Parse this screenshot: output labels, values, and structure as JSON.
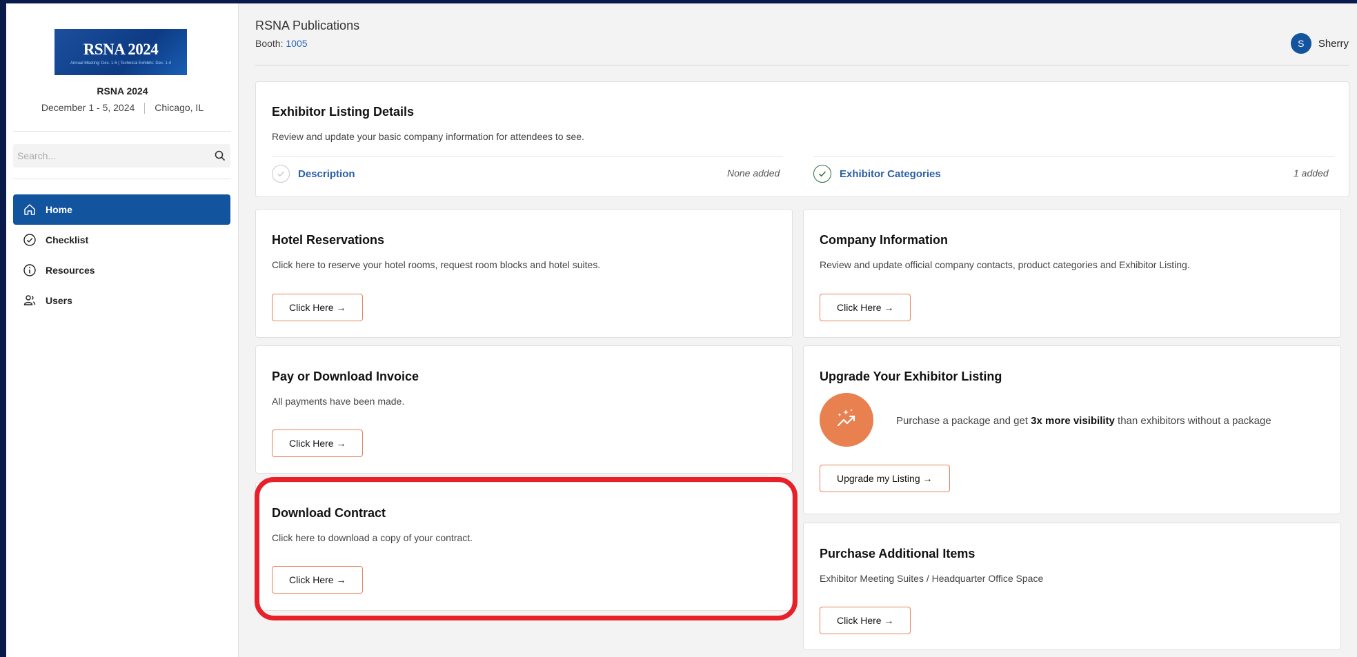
{
  "sidebar": {
    "logo": {
      "title": "RSNA 2024",
      "subtitle": "Annual Meeting: Dec. 1-5 | Technical Exhibits: Dec. 1-4"
    },
    "event_name": "RSNA 2024",
    "event_dates": "December 1 - 5, 2024",
    "event_location": "Chicago, IL",
    "search_placeholder": "Search...",
    "nav": [
      {
        "label": "Home",
        "icon": "home-icon",
        "active": true
      },
      {
        "label": "Checklist",
        "icon": "check-circle-icon",
        "active": false
      },
      {
        "label": "Resources",
        "icon": "info-icon",
        "active": false
      },
      {
        "label": "Users",
        "icon": "users-icon",
        "active": false
      }
    ]
  },
  "header": {
    "org_name": "RSNA Publications",
    "booth_label": "Booth:",
    "booth_number": "1005",
    "user_initial": "S",
    "user_name": "Sherry"
  },
  "cards": {
    "exhibitor_listing": {
      "title": "Exhibitor Listing Details",
      "description": "Review and update your basic company information for attendees to see.",
      "items": [
        {
          "label": "Description",
          "status": "None added",
          "complete": false
        },
        {
          "label": "Exhibitor Categories",
          "status": "1 added",
          "complete": true
        }
      ]
    },
    "hotel": {
      "title": "Hotel Reservations",
      "description": "Click here to reserve your hotel rooms, request room blocks and hotel suites.",
      "button": "Click Here →"
    },
    "company": {
      "title": "Company Information",
      "description": "Review and update official company contacts, product categories and Exhibitor Listing.",
      "button": "Click Here →"
    },
    "invoice": {
      "title": "Pay or Download Invoice",
      "description": "All payments have been made.",
      "button": "Click Here →"
    },
    "upgrade": {
      "title": "Upgrade Your Exhibitor Listing",
      "text_before": "Purchase a package and get ",
      "text_bold": "3x more visibility",
      "text_after": " than exhibitors without a package",
      "button": "Upgrade my Listing →"
    },
    "contract": {
      "title": "Download Contract",
      "description": "Click here to download a copy of your contract.",
      "button": "Click Here →"
    },
    "additional": {
      "title": "Purchase Additional Items",
      "description": "Exhibitor Meeting Suites / Headquarter Office Space",
      "button": "Click Here →"
    }
  },
  "colors": {
    "primary": "#12549e",
    "accent": "#e8804f",
    "highlight": "#e8202a",
    "link": "#2a5fa8",
    "success": "#2e6b3a"
  }
}
